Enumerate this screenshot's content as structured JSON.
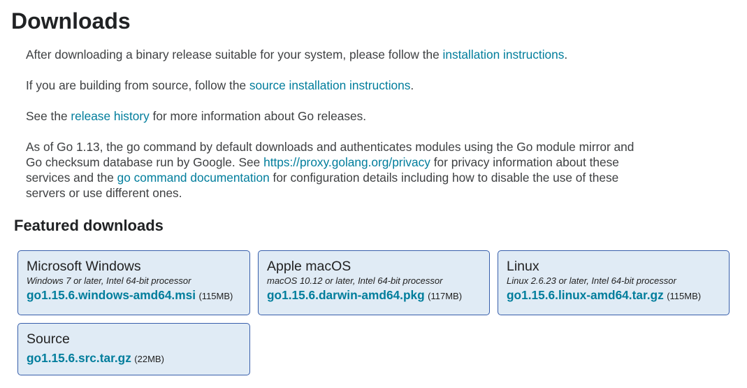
{
  "page": {
    "title": "Downloads"
  },
  "intro": {
    "p1_before": "After downloading a binary release suitable for your system, please follow the ",
    "p1_link": "installation instructions",
    "p1_after": ".",
    "p2_before": "If you are building from source, follow the ",
    "p2_link": "source installation instructions",
    "p2_after": ".",
    "p3_before": "See the ",
    "p3_link": "release history",
    "p3_after": " for more information about Go releases.",
    "p4_part1": "As of Go 1.13, the go command by default downloads and authenticates modules using the Go module mirror and Go checksum database run by Google. See ",
    "p4_link1": "https://proxy.golang.org/privacy",
    "p4_part2": " for privacy information about these services and the ",
    "p4_link2": "go command documentation",
    "p4_part3": " for configuration details including how to disable the use of these servers or use different ones."
  },
  "featured": {
    "heading": "Featured downloads",
    "cards": [
      {
        "os": "Microsoft Windows",
        "requirements": "Windows 7 or later, Intel 64-bit processor",
        "file": "go1.15.6.windows-amd64.msi",
        "size": "(115MB)"
      },
      {
        "os": "Apple macOS",
        "requirements": "macOS 10.12 or later, Intel 64-bit processor",
        "file": "go1.15.6.darwin-amd64.pkg",
        "size": "(117MB)"
      },
      {
        "os": "Linux",
        "requirements": "Linux 2.6.23 or later, Intel 64-bit processor",
        "file": "go1.15.6.linux-amd64.tar.gz",
        "size": "(115MB)"
      },
      {
        "os": "Source",
        "requirements": "",
        "file": "go1.15.6.src.tar.gz",
        "size": "(22MB)"
      }
    ]
  },
  "colors": {
    "link": "#007d9c",
    "card_background": "#e0ebf5",
    "card_border": "#375eab"
  }
}
